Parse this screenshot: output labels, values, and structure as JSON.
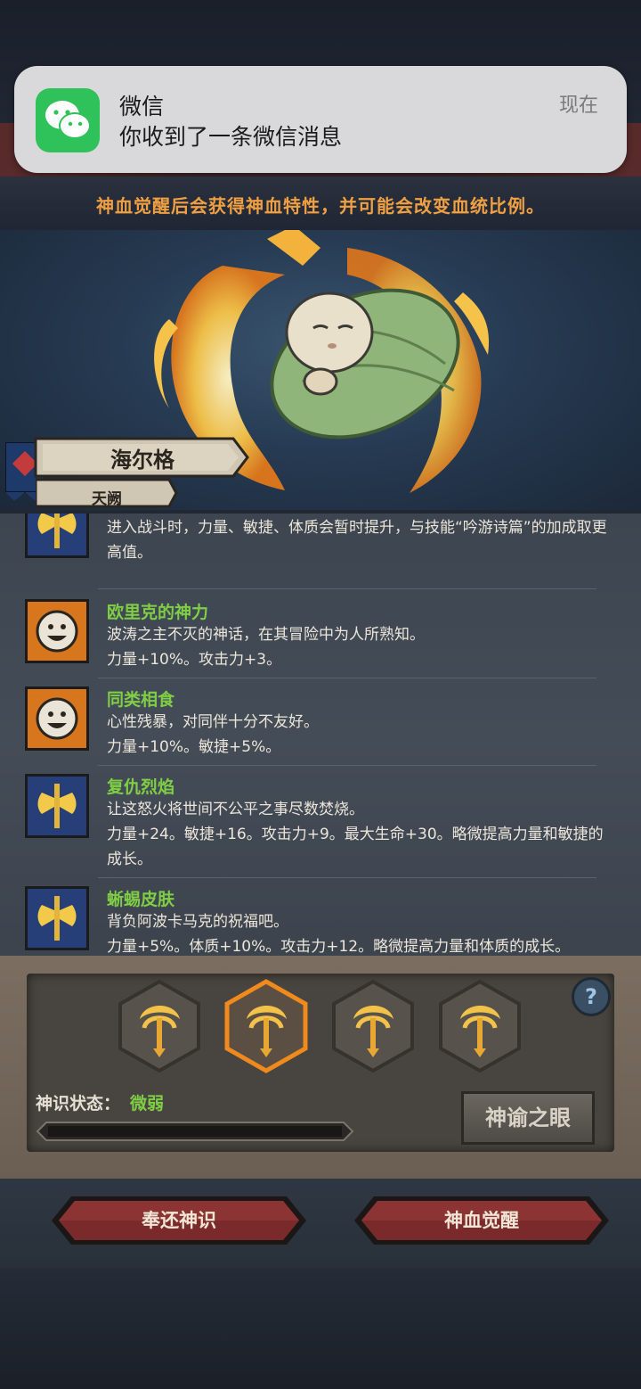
{
  "notification": {
    "app": "微信",
    "message": "你收到了一条微信消息",
    "time": "现在",
    "icon": "wechat-icon",
    "color": "#2fc25b"
  },
  "hint": "神血觉醒后会获得神血特性，并可能会改变血统比例。",
  "hero": {
    "name": "海尔格",
    "class": "天阙",
    "portrait": "swaddled-baby"
  },
  "traits": [
    {
      "icon": "axe-icon",
      "name": "",
      "desc": "进入战斗时，力量、敏捷、体质会暂时提升，与技能“吟游诗篇”的加成取更高值。"
    },
    {
      "icon": "smiley-icon",
      "name": "欧里克的神力",
      "desc": "波涛之主不灭的神话，在其冒险中为人所熟知。",
      "stats": "力量+10%。攻击力+3。"
    },
    {
      "icon": "smiley-icon",
      "name": "同类相食",
      "desc": "心性残暴，对同伴十分不友好。",
      "stats": "力量+10%。敏捷+5%。"
    },
    {
      "icon": "axe-icon",
      "name": "复仇烈焰",
      "desc": "让这怒火将世间不公平之事尽数焚烧。",
      "stats": "力量+24。敏捷+16。攻击力+9。最大生命+30。略微提高力量和敏捷的成长。"
    },
    {
      "icon": "axe-icon",
      "name": "蜥蜴皮肤",
      "desc": "背负阿波卡马克的祝福吧。",
      "stats": "力量+5%。体质+10%。攻击力+12。略微提高力量和体质的成长。"
    }
  ],
  "god_panel": {
    "slots": [
      "trident-icon",
      "trident-icon",
      "trident-icon",
      "trident-icon"
    ],
    "selected_slot": 1,
    "status_label": "神识状态：",
    "status_value": "微弱",
    "progress": 0,
    "eye_button": "神谕之眼",
    "help_icon": "question-icon"
  },
  "actions": {
    "return": "奉还神识",
    "awaken": "神血觉醒"
  },
  "colors": {
    "hint": "#f0a042",
    "trait_name": "#7fce46",
    "button_red": "#7a2a2a"
  }
}
